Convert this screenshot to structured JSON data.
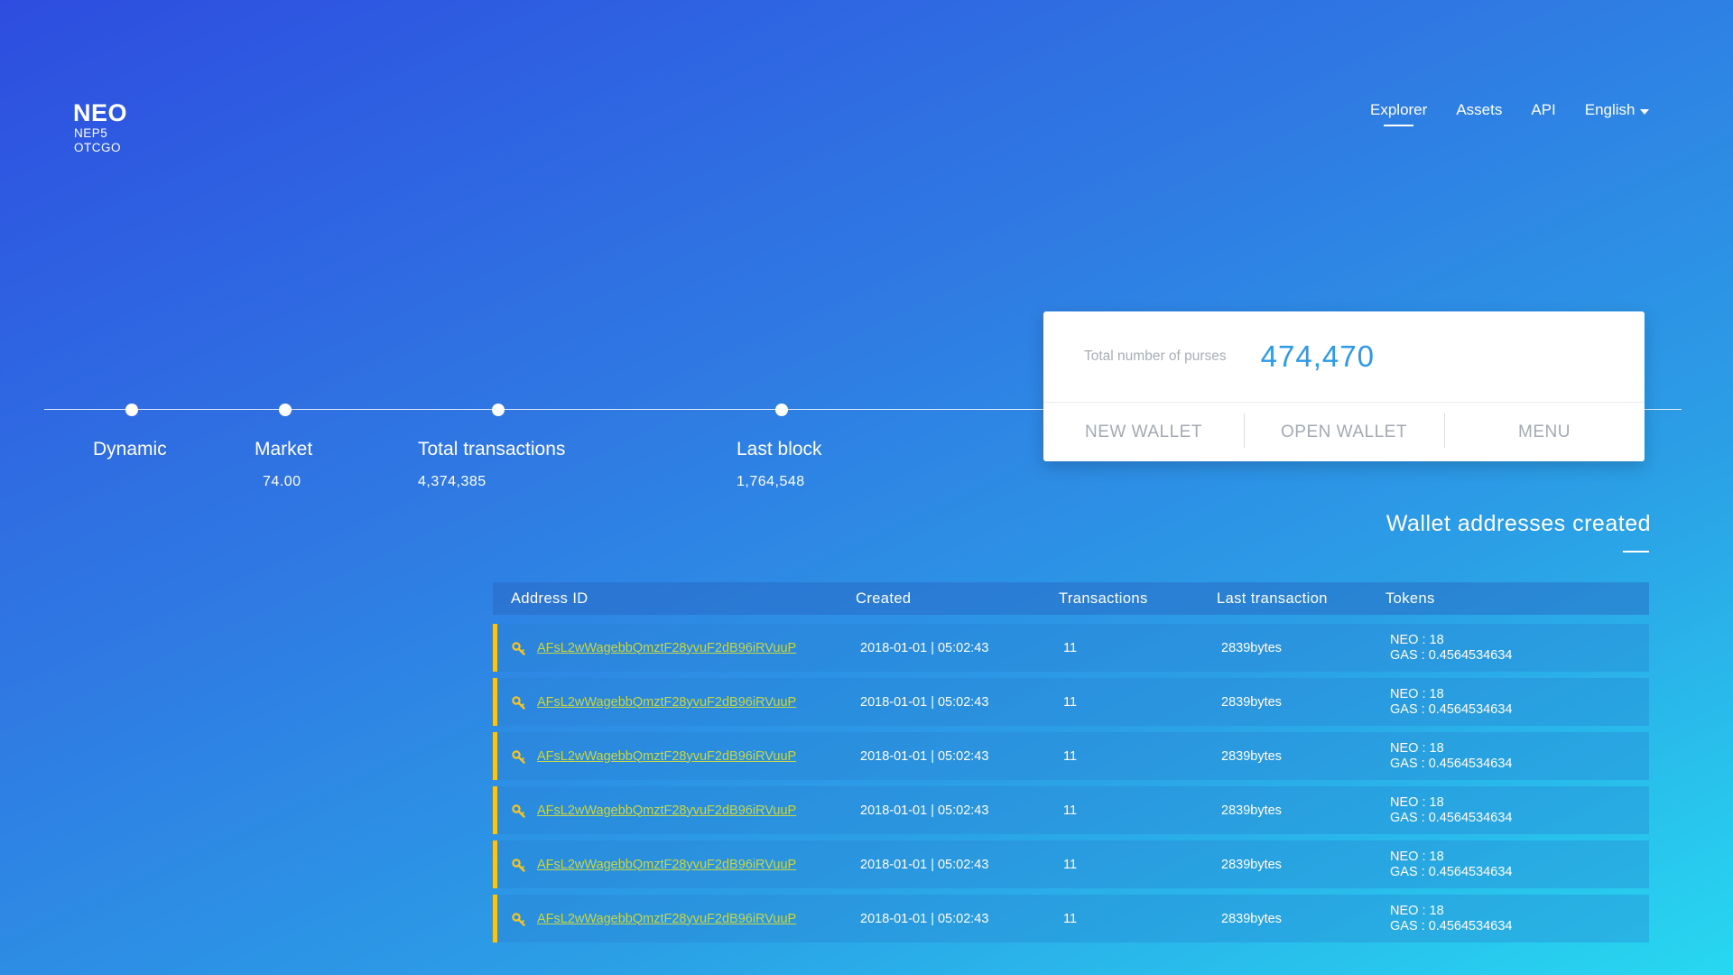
{
  "logo": {
    "title": "NEO",
    "line1": "NEP5",
    "line2": "OTCGO"
  },
  "nav": {
    "items": [
      {
        "label": "Explorer",
        "active": true
      },
      {
        "label": "Assets",
        "active": false
      },
      {
        "label": "API",
        "active": false
      }
    ],
    "language": "English"
  },
  "stats": [
    {
      "label": "Dynamic",
      "value": ""
    },
    {
      "label": "Market",
      "value": "74.00"
    },
    {
      "label": "Total transactions",
      "value": "4,374,385"
    },
    {
      "label": "Last block",
      "value": "1,764,548"
    }
  ],
  "wallet": {
    "label": "Total number of purses",
    "value": "474,470",
    "actions": [
      "NEW WALLET",
      "OPEN WALLET",
      "MENU"
    ]
  },
  "section": {
    "title": "Wallet addresses created"
  },
  "table": {
    "headers": [
      "Address ID",
      "Created",
      "Transactions",
      "Last transaction",
      "Tokens"
    ],
    "rows": [
      {
        "address": "AFsL2wWagebbQmztF28yvuF2dB96iRVuuP",
        "created": "2018-01-01 | 05:02:43",
        "transactions": "11",
        "last": "2839bytes",
        "neo": "NEO : 18",
        "gas": "GAS : 0.4564534634"
      },
      {
        "address": "AFsL2wWagebbQmztF28yvuF2dB96iRVuuP",
        "created": "2018-01-01 | 05:02:43",
        "transactions": "11",
        "last": "2839bytes",
        "neo": "NEO : 18",
        "gas": "GAS : 0.4564534634"
      },
      {
        "address": "AFsL2wWagebbQmztF28yvuF2dB96iRVuuP",
        "created": "2018-01-01 | 05:02:43",
        "transactions": "11",
        "last": "2839bytes",
        "neo": "NEO : 18",
        "gas": "GAS : 0.4564534634"
      },
      {
        "address": "AFsL2wWagebbQmztF28yvuF2dB96iRVuuP",
        "created": "2018-01-01 | 05:02:43",
        "transactions": "11",
        "last": "2839bytes",
        "neo": "NEO : 18",
        "gas": "GAS : 0.4564534634"
      },
      {
        "address": "AFsL2wWagebbQmztF28yvuF2dB96iRVuuP",
        "created": "2018-01-01 | 05:02:43",
        "transactions": "11",
        "last": "2839bytes",
        "neo": "NEO : 18",
        "gas": "GAS : 0.4564534634"
      },
      {
        "address": "AFsL2wWagebbQmztF28yvuF2dB96iRVuuP",
        "created": "2018-01-01 | 05:02:43",
        "transactions": "11",
        "last": "2839bytes",
        "neo": "NEO : 18",
        "gas": "GAS : 0.4564534634"
      }
    ]
  },
  "icons": {
    "row": "key-icon",
    "language": "caret-down-icon"
  },
  "colors": {
    "accent": "#2e9ae6",
    "row_marker": "#f6c522",
    "link": "#c5d64a"
  }
}
